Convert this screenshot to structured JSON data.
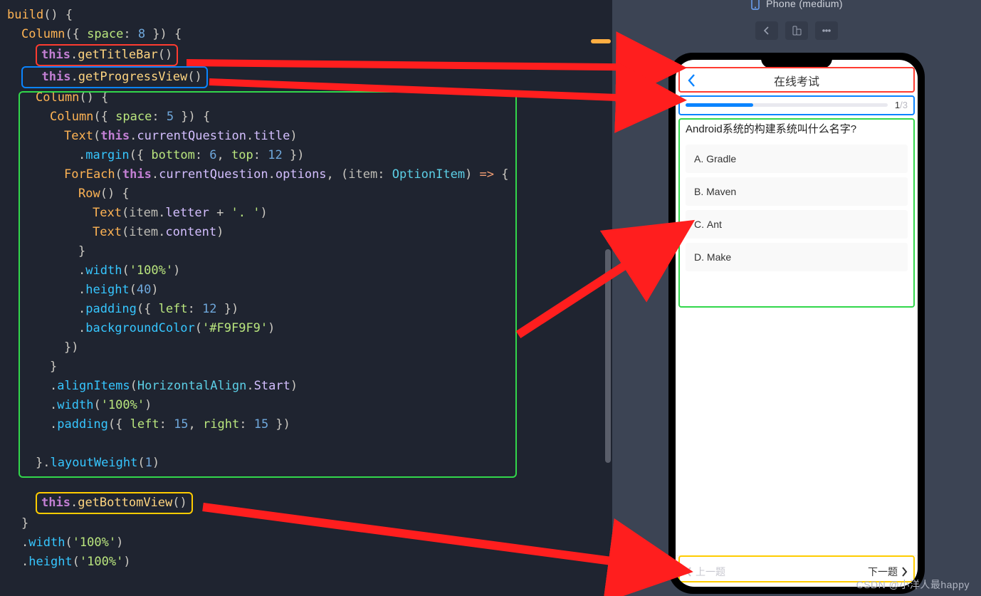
{
  "device_label": "Phone (medium)",
  "watermark": "CSDN @小洋人最happy",
  "code": {
    "l1": "build",
    "l2": "Column",
    "l2a": "space",
    "l2n": "8",
    "l3a": "this",
    "l3b": "getTitleBar",
    "l4a": "this",
    "l4b": "getProgressView",
    "l5": "Column",
    "l6": "Column",
    "l6a": "space",
    "l6n": "5",
    "l7": "Text",
    "l7a": "this",
    "l7b": "currentQuestion",
    "l7c": "title",
    "l8": "margin",
    "l8a": "bottom",
    "l8n1": "6",
    "l8b": "top",
    "l8n2": "12",
    "l9": "ForEach",
    "l9a": "this",
    "l9b": "currentQuestion",
    "l9c": "options",
    "l9d": "item",
    "l9e": "OptionItem",
    "l10": "Row",
    "l11": "Text",
    "l11a": "item",
    "l11b": "letter",
    "l11c": "'. '",
    "l12": "Text",
    "l12a": "item",
    "l12b": "content",
    "l14": "width",
    "l14s": "'100%'",
    "l15": "height",
    "l15n": "40",
    "l16": "padding",
    "l16a": "left",
    "l16n": "12",
    "l17": "backgroundColor",
    "l17s": "'#F9F9F9'",
    "l20": "alignItems",
    "l20a": "HorizontalAlign",
    "l20b": "Start",
    "l21": "width",
    "l21s": "'100%'",
    "l22": "padding",
    "l22a": "left",
    "l22n1": "15",
    "l22b": "right",
    "l22n2": "15",
    "l23": "layoutWeight",
    "l23n": "1",
    "l24a": "this",
    "l24b": "getBottomView",
    "l26": "width",
    "l26s": "'100%'",
    "l27": "height",
    "l27s": "'100%'"
  },
  "app": {
    "title": "在线考试",
    "progress": {
      "current": "1",
      "sep": "/",
      "total": "3",
      "fill_pct": 33
    },
    "question": "Android系统的构建系统叫什么名字?",
    "options": [
      {
        "letter": "A",
        "content": "Gradle"
      },
      {
        "letter": "B",
        "content": "Maven"
      },
      {
        "letter": "C",
        "content": "Ant"
      },
      {
        "letter": "D",
        "content": "Make"
      }
    ],
    "prev": "上一题",
    "next": "下一题"
  }
}
